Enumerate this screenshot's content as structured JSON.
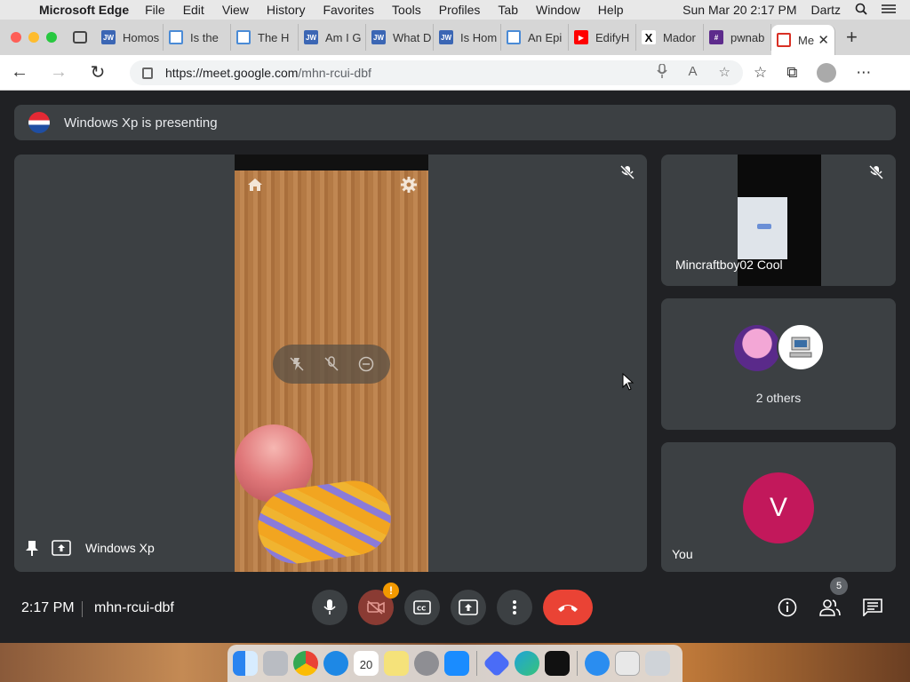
{
  "menubar": {
    "app_name": "Microsoft Edge",
    "items": [
      "File",
      "Edit",
      "View",
      "History",
      "Favorites",
      "Tools",
      "Profiles",
      "Tab",
      "Window",
      "Help"
    ],
    "datetime": "Sun Mar 20  2:17 PM",
    "user": "Dartz"
  },
  "browser": {
    "tabs": [
      {
        "label": "Homos",
        "favicon": "jw-icon"
      },
      {
        "label": "Is the",
        "favicon": "doc-icon"
      },
      {
        "label": "The H",
        "favicon": "doc-icon"
      },
      {
        "label": "Am I G",
        "favicon": "jw-icon"
      },
      {
        "label": "What D",
        "favicon": "jw-icon"
      },
      {
        "label": "Is Hom",
        "favicon": "jw-icon"
      },
      {
        "label": "An Epi",
        "favicon": "doc-icon"
      },
      {
        "label": "EdifyH",
        "favicon": "youtube-icon"
      },
      {
        "label": "Mador",
        "favicon": "x-icon"
      },
      {
        "label": "pwnab",
        "favicon": "hash-icon"
      },
      {
        "label": "Me",
        "favicon": "record-icon",
        "active": true
      }
    ],
    "url_host": "https://meet.google.com",
    "url_path": "/mhn-rcui-dbf"
  },
  "meet": {
    "presenting_text": "Windows Xp is presenting",
    "main_tile_name": "Windows Xp",
    "participants": [
      {
        "name": "Mincraftboy02 Cool"
      },
      {
        "name": "2 others"
      },
      {
        "name": "You",
        "initial": "V"
      }
    ],
    "time": "2:17 PM",
    "meeting_code": "mhn-rcui-dbf",
    "camera_alert": "!",
    "people_count": "5"
  },
  "colors": {
    "background": "#202124",
    "tile": "#3c4043",
    "end_call": "#ea4335",
    "you_avatar": "#c2185b",
    "alert": "#f29900"
  },
  "dock": {
    "calendar_day": "20",
    "apps": [
      "finder",
      "launchpad",
      "chrome",
      "safari",
      "calendar",
      "notes",
      "system-preferences",
      "app-store",
      "vscode",
      "edge",
      "terminal",
      "app-store-2",
      "script-editor",
      "trash"
    ]
  }
}
